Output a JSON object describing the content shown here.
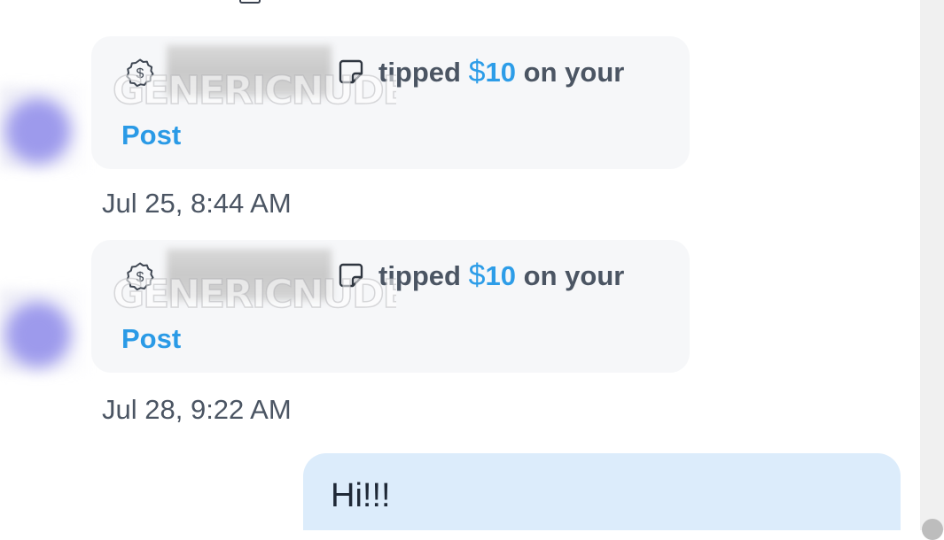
{
  "conversation": {
    "notifications": [
      {
        "tip_verb": "tipped",
        "currency_symbol": "$",
        "amount": "10",
        "suffix": "on your",
        "link_label": "Post",
        "watermark": "GENERICNUDES",
        "timestamp": "Jul 25, 8:44 AM"
      },
      {
        "tip_verb": "tipped",
        "currency_symbol": "$",
        "amount": "10",
        "suffix": "on your",
        "link_label": "Post",
        "watermark": "GENERICNUDES",
        "timestamp": "Jul 28, 9:22 AM"
      }
    ],
    "outgoing_message": {
      "text": "Hi!!!"
    }
  },
  "icons": {
    "tip": "dollar-badge-icon",
    "post": "post-note-icon"
  },
  "colors": {
    "accent": "#2a9ae6",
    "notification_bg": "#f6f7f9",
    "outgoing_bg": "#dcecfb",
    "text_primary": "#4b5563"
  }
}
